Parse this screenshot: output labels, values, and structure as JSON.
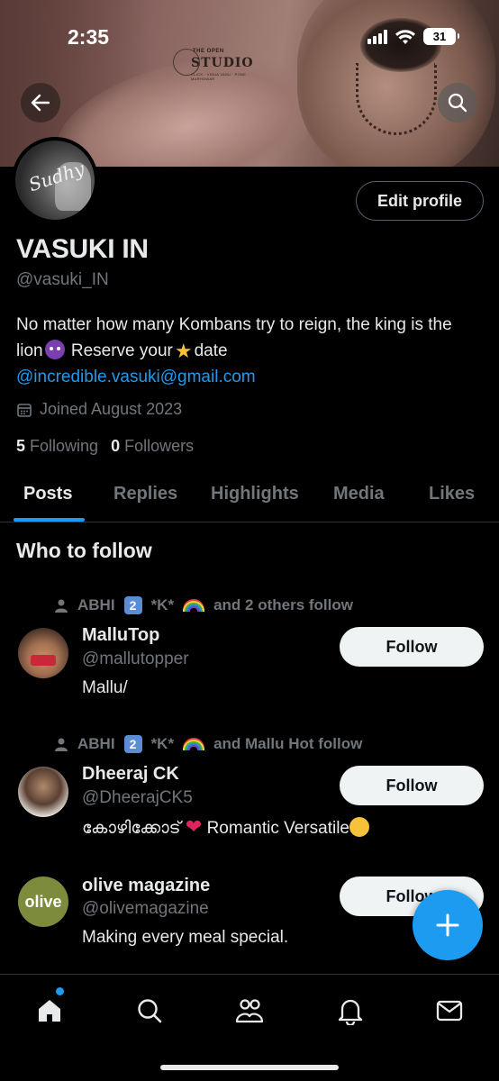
{
  "status_bar": {
    "time": "2:35",
    "battery": "31"
  },
  "banner": {
    "logo_top": "THE OPEN",
    "logo_main": "STUDIO",
    "logo_sub": "CLICK · VISUA VASU · PONE · MARHOWAR"
  },
  "profile": {
    "avatar_signature": "Sudhy",
    "edit_button": "Edit profile",
    "name": "VASUKI IN",
    "handle": "@vasuki_IN",
    "bio_line1": "No matter how many Kombans try to reign, the king is the",
    "bio_line2_a": "lion",
    "bio_line2_b": "Reserve your",
    "bio_line2_c": "date",
    "bio_link": "@incredible.vasuki@gmail.com",
    "joined": "Joined August 2023",
    "following_count": "5",
    "following_label": "Following",
    "followers_count": "0",
    "followers_label": "Followers"
  },
  "tabs": [
    "Posts",
    "Replies",
    "Highlights",
    "Media",
    "Likes"
  ],
  "who_to_follow": {
    "title": "Who to follow",
    "items": [
      {
        "social_a": "ABHI",
        "social_key": "2",
        "social_b": "*K*",
        "social_c": "and 2 others follow",
        "name": "MalluTop",
        "handle": "@mallutopper",
        "bio": "Mallu/",
        "button": "Follow"
      },
      {
        "social_a": "ABHI",
        "social_key": "2",
        "social_b": "*K*",
        "social_c": "and Mallu Hot follow",
        "name": "Dheeraj CK",
        "handle": "@DheerajCK5",
        "bio_a": "കോഴിക്കോട്",
        "bio_b": "Romantic Versatile",
        "button": "Follow"
      },
      {
        "name": "olive magazine",
        "handle": "@olivemagazine",
        "bio": "Making every meal special.",
        "avatar_text": "olive",
        "button": "Follow"
      }
    ]
  },
  "colors": {
    "accent": "#1d9bf0",
    "muted": "#71767b",
    "text": "#e7e9ea",
    "olive": "#7d8b3d"
  }
}
